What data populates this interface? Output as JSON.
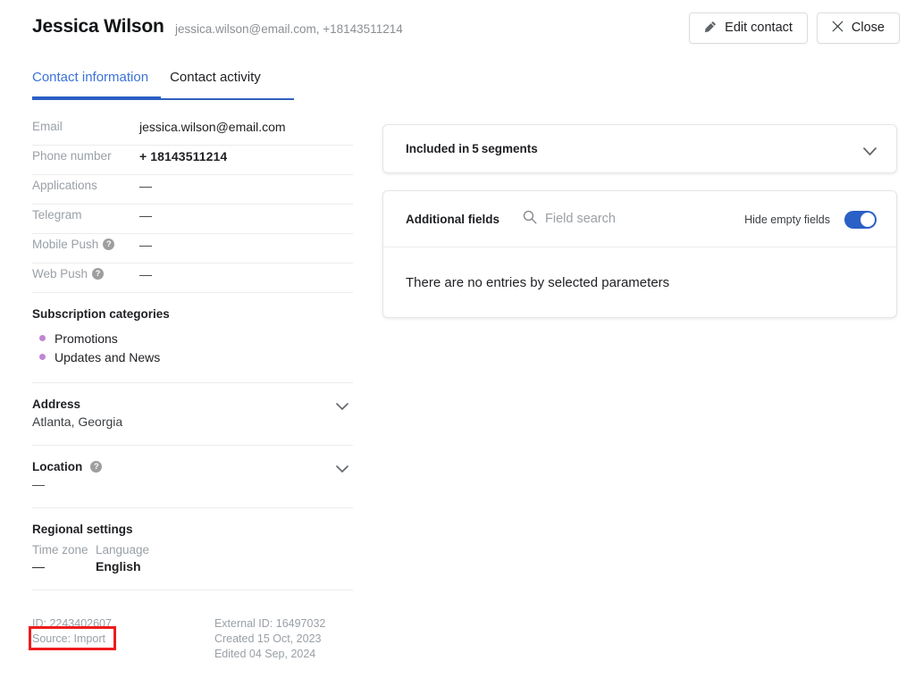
{
  "header": {
    "contact_name": "Jessica Wilson",
    "contact_subtitle": "jessica.wilson@email.com, +18143511214",
    "edit_button": "Edit contact",
    "close_button": "Close"
  },
  "tabs": [
    {
      "label": "Contact information",
      "active": true
    },
    {
      "label": "Contact activity",
      "active": false
    }
  ],
  "fields": [
    {
      "label": "Email",
      "value": "jessica.wilson@email.com",
      "help": false
    },
    {
      "label": "Phone number",
      "value": "+ 18143511214",
      "help": false
    },
    {
      "label": "Applications",
      "value": "—",
      "help": false
    },
    {
      "label": "Telegram",
      "value": "—",
      "help": false
    },
    {
      "label": "Mobile Push",
      "value": "—",
      "help": true
    },
    {
      "label": "Web Push",
      "value": "—",
      "help": true
    }
  ],
  "subscription": {
    "title": "Subscription categories",
    "items": [
      "Promotions",
      "Updates and News"
    ],
    "bullet_color": "#bf86d4"
  },
  "address": {
    "title": "Address",
    "value": "Atlanta, Georgia"
  },
  "location": {
    "title": "Location",
    "value": "—"
  },
  "regional": {
    "title": "Regional settings",
    "timezone_label": "Time zone",
    "timezone_value": "—",
    "language_label": "Language",
    "language_value": "English"
  },
  "meta": {
    "id": "ID: 2243402607",
    "source": "Source:  Import",
    "external_id": "External ID: 16497032",
    "created": "Created 15 Oct, 2023",
    "edited": "Edited 04 Sep, 2024",
    "highlight_color": "#ee1c1c"
  },
  "segments": {
    "prefix": "Included in",
    "count": "5",
    "suffix": "segments"
  },
  "additional_fields": {
    "title": "Additional fields",
    "search_placeholder": "Field search",
    "hide_empty_label": "Hide empty fields",
    "hide_empty_on": true,
    "empty_message": "There are no entries by selected parameters"
  },
  "colors": {
    "accent_blue": "#2b60c6",
    "tab_active": "#3b73d9"
  }
}
